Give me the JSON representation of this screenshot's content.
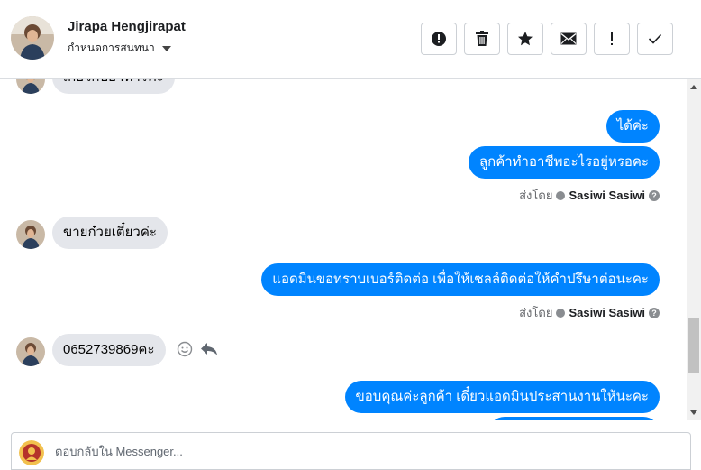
{
  "header": {
    "contact_name": "Jirapa Hengjirapat",
    "subtitle": "กำหนดการสนทนา",
    "actions": [
      {
        "icon": "alert-circle-icon",
        "label": "!"
      },
      {
        "icon": "trash-icon"
      },
      {
        "icon": "star-icon"
      },
      {
        "icon": "envelope-icon"
      },
      {
        "icon": "exclamation-icon",
        "label": "!"
      },
      {
        "icon": "check-icon"
      }
    ]
  },
  "thread": {
    "partial_top_message": "เกี่ยวกับอาหารคะ",
    "msg_out_1": "ได้ค่ะ",
    "msg_out_2": "ลูกค้าทำอาชีพอะไรอยู่หรอคะ",
    "sent_by_label": "ส่งโดย",
    "sent_by_name": "Sasiwi Sasiwi",
    "msg_in_1": "ขายก๋วยเตี๋ยวค่ะ",
    "msg_out_3": "แอดมินขอทราบเบอร์ติดต่อ เพื่อให้เซลล์ติดต่อให้คำปรึษาต่อนะคะ",
    "sent_by_label_2": "ส่งโดย",
    "sent_by_name_2": "Sasiwi Sasiwi",
    "msg_in_2": "0652739869คะ",
    "msg_out_4": "ขอบคุณค่ะลูกค้า เดี๋ยวแอดมินประสานงานให้นะคะ"
  },
  "composer": {
    "placeholder": "ตอบกลับใน Messenger..."
  },
  "colors": {
    "outgoing_bubble": "#0084ff",
    "incoming_bubble": "#e4e6eb"
  }
}
